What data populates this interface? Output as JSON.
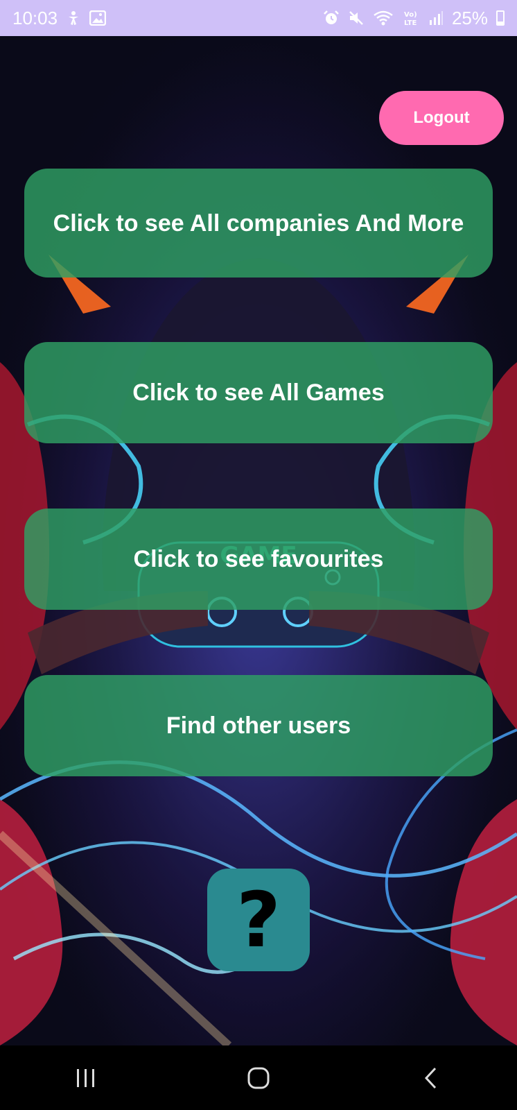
{
  "status_bar": {
    "time": "10:03",
    "battery": "25%",
    "left_icons": [
      "accessibility-icon",
      "image-icon"
    ],
    "right_icons": [
      "alarm-icon",
      "mute-icon",
      "wifi-icon",
      "volte-icon",
      "signal-icon",
      "battery-icon"
    ]
  },
  "header": {
    "logout_label": "Logout"
  },
  "menu": {
    "companies_label": "Click to see All companies And More",
    "games_label": "Click to see All Games",
    "favourites_label": "Click to see favourites",
    "users_label": "Find other users"
  },
  "help": {
    "glyph": "?"
  },
  "nav_bar": {
    "icons": [
      "recents-icon",
      "home-icon",
      "back-icon"
    ]
  },
  "colors": {
    "status_bar": "#cfc0f8",
    "logout": "#ff6ab0",
    "menu_button": "#30a064",
    "help_button": "#2a8a90"
  }
}
